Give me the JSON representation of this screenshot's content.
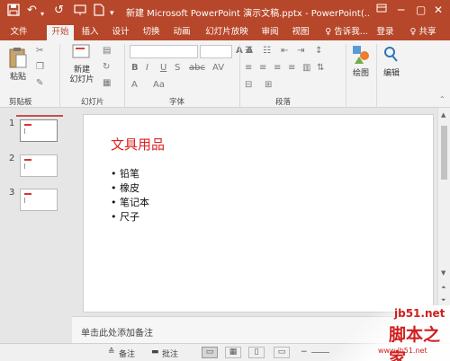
{
  "colors": {
    "accent": "#b7472a",
    "title_red": "#e02020"
  },
  "titlebar": {
    "title": "新建 Microsoft PowerPoint 演示文稿.pptx - PowerPoint(...",
    "icons": [
      "save-icon",
      "undo-icon",
      "redo-icon",
      "refresh-icon",
      "presentation-icon",
      "new-file-icon",
      "open-icon",
      "customize-icon",
      "ribbon-display-icon",
      "minimize-icon",
      "restore-icon",
      "close-icon"
    ]
  },
  "tabs": [
    {
      "label": "文件"
    },
    {
      "label": "开始"
    },
    {
      "label": "插入"
    },
    {
      "label": "设计"
    },
    {
      "label": "切换"
    },
    {
      "label": "动画"
    },
    {
      "label": "幻灯片放映"
    },
    {
      "label": "审阅"
    },
    {
      "label": "视图"
    },
    {
      "label": "♀ 告诉我..."
    },
    {
      "label": "登录"
    },
    {
      "label": "♀ 共享"
    }
  ],
  "ribbon": {
    "paste": "粘贴",
    "new_slide": "新建\n幻灯片",
    "font_label_a": "A A",
    "draw": "绘图",
    "edit": "编辑",
    "groups": [
      "剪贴板",
      "幻灯片",
      "字体",
      "段落"
    ]
  },
  "slides": [
    {
      "num": "1"
    },
    {
      "num": "2"
    },
    {
      "num": "3"
    }
  ],
  "slide": {
    "title": "文具用品",
    "bullets": [
      "铅笔",
      "橡皮",
      "笔记本",
      "尺子"
    ]
  },
  "notes_placeholder": "单击此处添加备注",
  "statusbar": {
    "notes": "备注",
    "comments": "批注"
  },
  "watermark": {
    "site": "jb51.net",
    "name": "脚本之家",
    "url": "www.jb51.net"
  }
}
